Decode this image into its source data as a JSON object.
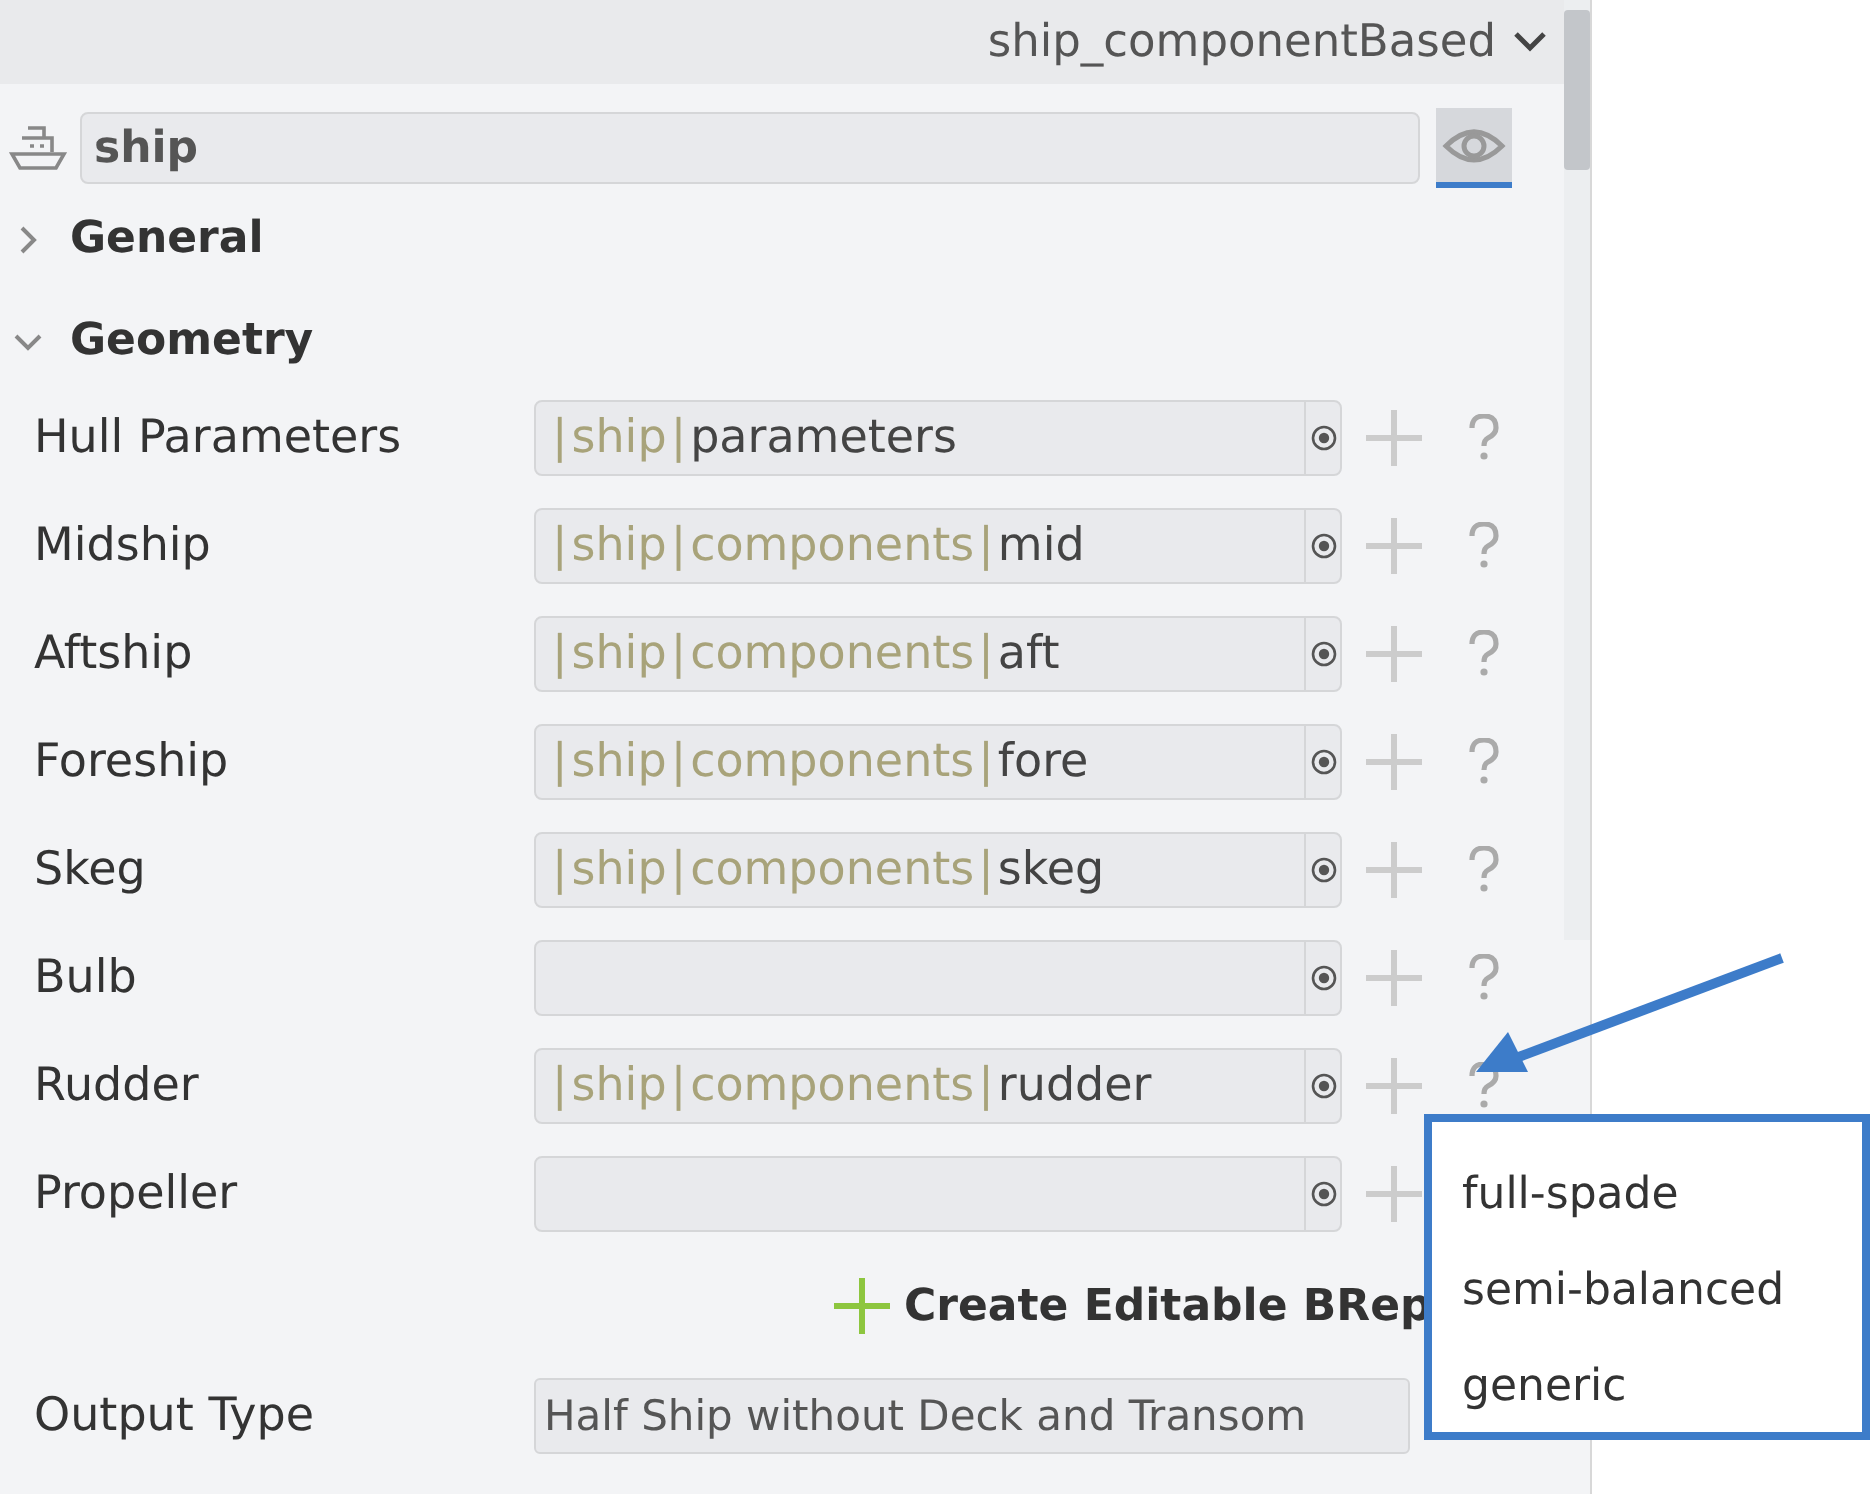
{
  "selector": {
    "value": "ship_componentBased"
  },
  "object": {
    "name": "ship"
  },
  "sections": [
    {
      "title": "General",
      "expanded": false
    },
    {
      "title": "Geometry",
      "expanded": true
    }
  ],
  "parameters": [
    {
      "label": "Hull Parameters",
      "path": "|ship|parameters"
    },
    {
      "label": "Midship",
      "path": "|ship|components|mid"
    },
    {
      "label": "Aftship",
      "path": "|ship|components|aft"
    },
    {
      "label": "Foreship",
      "path": "|ship|components|fore"
    },
    {
      "label": "Skeg",
      "path": "|ship|components|skeg"
    },
    {
      "label": "Bulb"
    },
    {
      "label": "Rudder",
      "path": "|ship|components|rudder"
    },
    {
      "label": "Propeller"
    }
  ],
  "create_button": {
    "label": "Create Editable BRep"
  },
  "output_type": {
    "label": "Output Type",
    "value": "Half Ship without Deck and Transom"
  },
  "callout": {
    "options": [
      "full-spade",
      "semi-balanced",
      "generic"
    ]
  }
}
